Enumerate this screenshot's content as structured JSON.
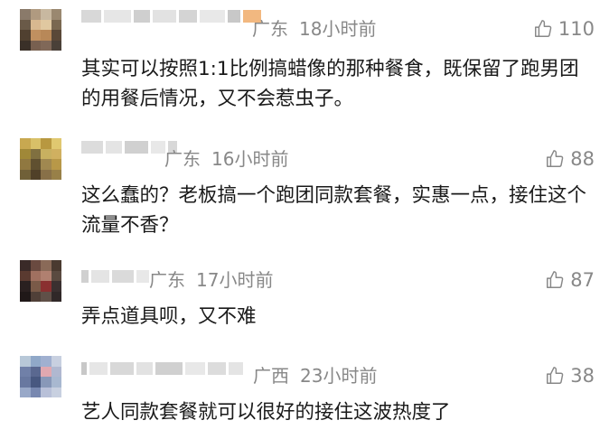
{
  "comments": [
    {
      "location": "广东",
      "time": "18小时前",
      "likes": "110",
      "text": "其实可以按照1:1比例搞蜡像的那种餐食，既保留了跑男团的用餐后情况，又不会惹虫子。"
    },
    {
      "location": "广东",
      "time": "16小时前",
      "likes": "88",
      "text": "这么蠢的？老板搞一个跑团同款套餐，实惠一点，接住这个流量不香？"
    },
    {
      "location": "广东",
      "time": "17小时前",
      "likes": "87",
      "text": "弄点道具呗，又不难"
    },
    {
      "location": "广西",
      "time": "23小时前",
      "likes": "38",
      "text": "艺人同款套餐就可以很好的接住这波热度了"
    }
  ],
  "icons": {
    "like": "thumbs-up-icon"
  },
  "colors": {
    "meta": "#888888",
    "text": "#1a1a1a",
    "like": "#888888"
  }
}
